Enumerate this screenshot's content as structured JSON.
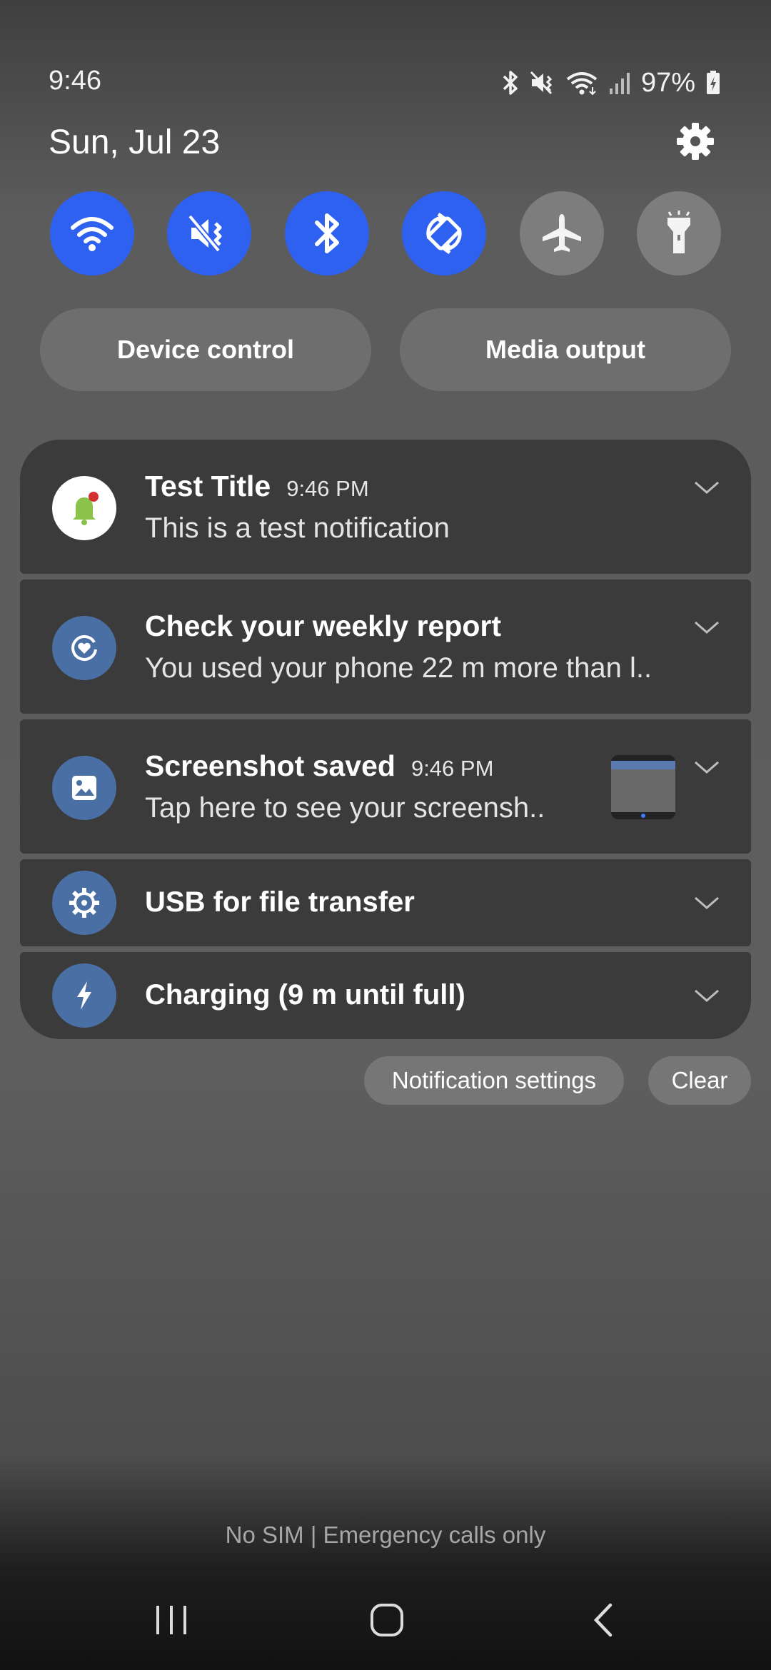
{
  "status_bar": {
    "time": "9:46",
    "battery": "97%",
    "icons": [
      "bluetooth-icon",
      "mute-vibrate-icon",
      "wifi-icon",
      "signal-icon",
      "battery-charging-icon"
    ]
  },
  "header": {
    "date": "Sun, Jul 23",
    "settings_icon": "gear-icon"
  },
  "quick_settings": [
    {
      "name": "wifi",
      "icon": "wifi-icon",
      "state": "on"
    },
    {
      "name": "sound",
      "icon": "mute-icon",
      "state": "on"
    },
    {
      "name": "bluetooth",
      "icon": "bluetooth-icon",
      "state": "on"
    },
    {
      "name": "auto-rotate",
      "icon": "rotate-icon",
      "state": "on"
    },
    {
      "name": "airplane-mode",
      "icon": "airplane-icon",
      "state": "off"
    },
    {
      "name": "flashlight",
      "icon": "flashlight-icon",
      "state": "off"
    }
  ],
  "buttons": {
    "device_control": "Device control",
    "media_output": "Media output"
  },
  "notifications": [
    {
      "title": "Test Title",
      "time": "9:46 PM",
      "body": "This is a test notification",
      "icon": "bell-icon"
    },
    {
      "title": "Check your weekly report",
      "time": "",
      "body": "You used your phone 22 m more than l..",
      "icon": "digital-wellbeing-icon"
    },
    {
      "title": "Screenshot saved",
      "time": "9:46 PM",
      "body": "Tap here to see your screensh..",
      "icon": "image-icon"
    },
    {
      "title": "USB for file transfer",
      "time": "",
      "body": "",
      "icon": "usb-settings-icon"
    },
    {
      "title": "Charging (9 m until full)",
      "time": "",
      "body": "",
      "icon": "lightning-icon"
    }
  ],
  "actions": {
    "notification_settings": "Notification settings",
    "clear": "Clear"
  },
  "footer": {
    "carrier": "No SIM | Emergency calls only"
  },
  "colors": {
    "toggle_on": "#2f61f0",
    "toggle_off": "#7d7d7d",
    "notification_card": "#3b3b3b",
    "app_icon_blue": "#4a6fa5"
  }
}
